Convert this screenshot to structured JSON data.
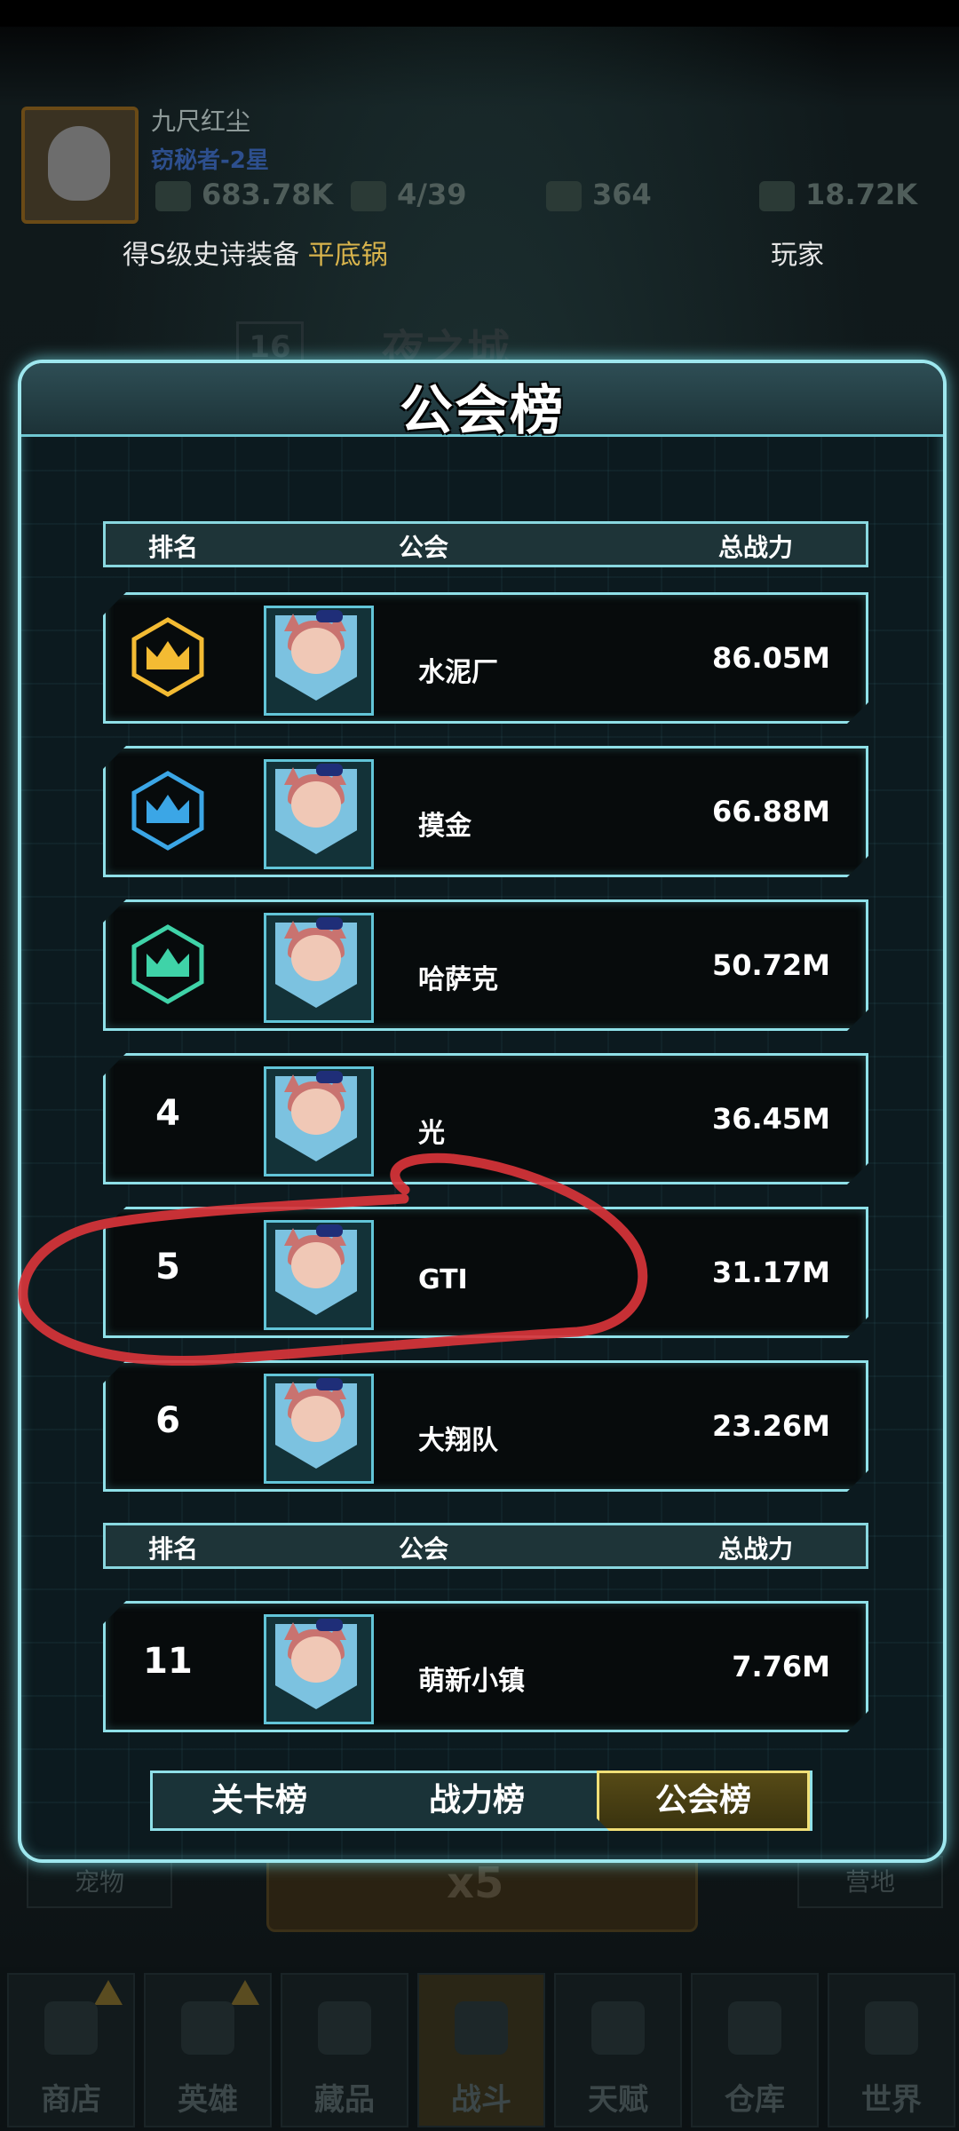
{
  "player": {
    "name": "九尺红尘",
    "title": "窃秘者-2星",
    "resources": [
      {
        "icon": "energy-icon",
        "value": "683.78K"
      },
      {
        "icon": "stamina-icon",
        "value": "4/39"
      },
      {
        "icon": "diamond-icon",
        "value": "364"
      },
      {
        "icon": "cash-icon",
        "value": "18.72K"
      }
    ]
  },
  "ticker": {
    "prefix": "得S级史诗装备",
    "item": "平底锅",
    "right": "玩家"
  },
  "background": {
    "city": "夜之城",
    "level": "16",
    "left_button": "宠物",
    "right_button": "营地",
    "big_button": "x5"
  },
  "modal": {
    "title": "公会榜",
    "header": {
      "rank": "排名",
      "guild": "公会",
      "power": "总战力"
    },
    "rows": [
      {
        "rank": "1",
        "guild": "水泥厂",
        "power": "86.05M",
        "crown": "gold"
      },
      {
        "rank": "2",
        "guild": "摸金",
        "power": "66.88M",
        "crown": "blue"
      },
      {
        "rank": "3",
        "guild": "哈萨克",
        "power": "50.72M",
        "crown": "green"
      },
      {
        "rank": "4",
        "guild": "光",
        "power": "36.45M"
      },
      {
        "rank": "5",
        "guild": "GTI",
        "power": "31.17M"
      },
      {
        "rank": "6",
        "guild": "大翔队",
        "power": "23.26M"
      }
    ],
    "my_row": {
      "rank": "11",
      "guild": "萌新小镇",
      "power": "7.76M"
    },
    "tabs": [
      "关卡榜",
      "战力榜",
      "公会榜"
    ],
    "active_tab": 2
  },
  "bottom_nav": [
    "商店",
    "英雄",
    "藏品",
    "战斗",
    "天赋",
    "仓库",
    "世界"
  ],
  "colors": {
    "accent": "#8fe0e8",
    "gold": "#f0c040",
    "annotation": "#d8343a"
  }
}
